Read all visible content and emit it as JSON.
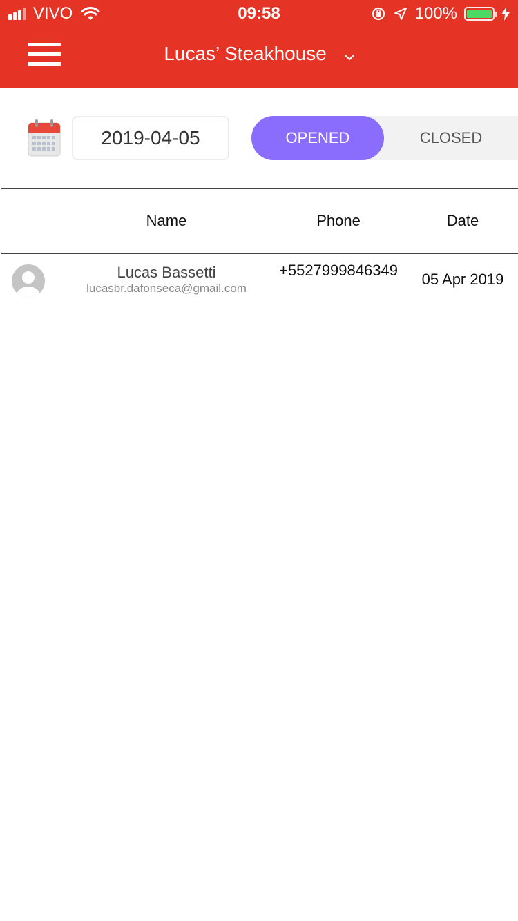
{
  "status_bar": {
    "carrier": "VIVO",
    "time": "09:58",
    "battery_percent": "100%",
    "battery_level": 1.0,
    "battery_color": "#4cd964"
  },
  "header": {
    "title": "Lucas’ Steakhouse",
    "background_color": "#e53325",
    "menu_icon": "hamburger-menu-icon",
    "dropdown_icon": "chevron-down-icon"
  },
  "filters": {
    "calendar_icon": "calendar-icon",
    "date_value": "2019-04-05",
    "segments": [
      {
        "label": "OPENED",
        "active": true
      },
      {
        "label": "CLOSED",
        "active": false
      }
    ],
    "active_color": "#8a6dfc"
  },
  "table": {
    "columns": [
      "Name",
      "Phone",
      "Date"
    ],
    "rows": [
      {
        "avatar_icon": "default-avatar-icon",
        "name": "Lucas Bassetti",
        "email": "lucasbr.dafonseca@gmail.com",
        "phone": "+5527999846349",
        "date": "05 Apr 2019"
      }
    ]
  }
}
